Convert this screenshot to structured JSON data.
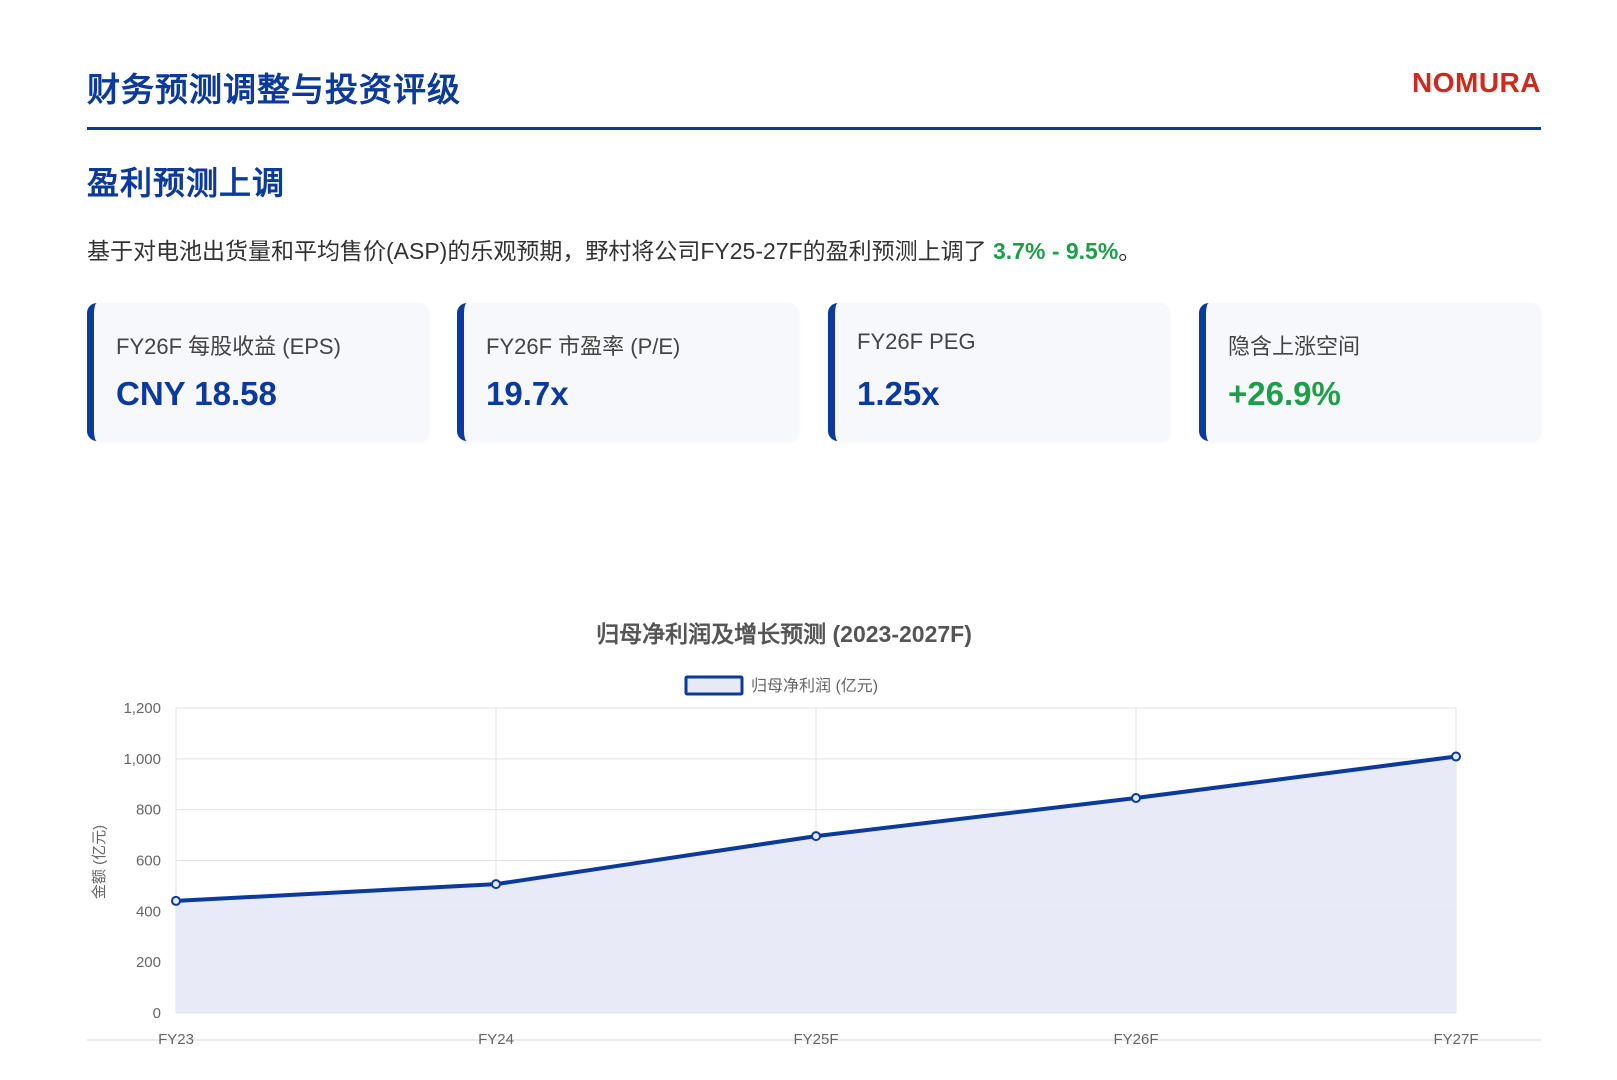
{
  "header": {
    "title": "财务预测调整与投资评级",
    "brand": "NOMURA"
  },
  "section": {
    "title": "盈利预测上调",
    "intro_prefix": "基于对电池出货量和平均售价(ASP)的乐观预期，野村将公司FY25-27F的盈利预测上调了 ",
    "intro_highlight": "3.7% - 9.5%",
    "intro_suffix": "。"
  },
  "cards": [
    {
      "label": "FY26F 每股收益 (EPS)",
      "value": "CNY 18.58"
    },
    {
      "label": "FY26F 市盈率 (P/E)",
      "value": "19.7x"
    },
    {
      "label": "FY26F PEG",
      "value": "1.25x"
    },
    {
      "label": "隐含上涨空间",
      "value": "+26.9%"
    }
  ],
  "colors": {
    "primary": "#0b3a9c",
    "brand": "#d0281c",
    "positive": "#1e9e4a",
    "fill": "#e6e9f6",
    "grid": "#e3e3e3"
  },
  "chart_data": {
    "type": "area",
    "title": "归母净利润及增长预测 (2023-2027F)",
    "categories": [
      "FY23",
      "FY24",
      "FY25F",
      "FY26F",
      "FY27F"
    ],
    "series": [
      {
        "name": "归母净利润 (亿元)",
        "values": [
          441,
          507,
          696,
          846,
          1009
        ]
      }
    ],
    "xlabel": "",
    "ylabel": "金额 (亿元)",
    "ylim": [
      0,
      1200
    ],
    "yticks": [
      "0",
      "200",
      "400",
      "600",
      "800",
      "1,000",
      "1,200"
    ],
    "grid": true,
    "legend": "top-center"
  }
}
